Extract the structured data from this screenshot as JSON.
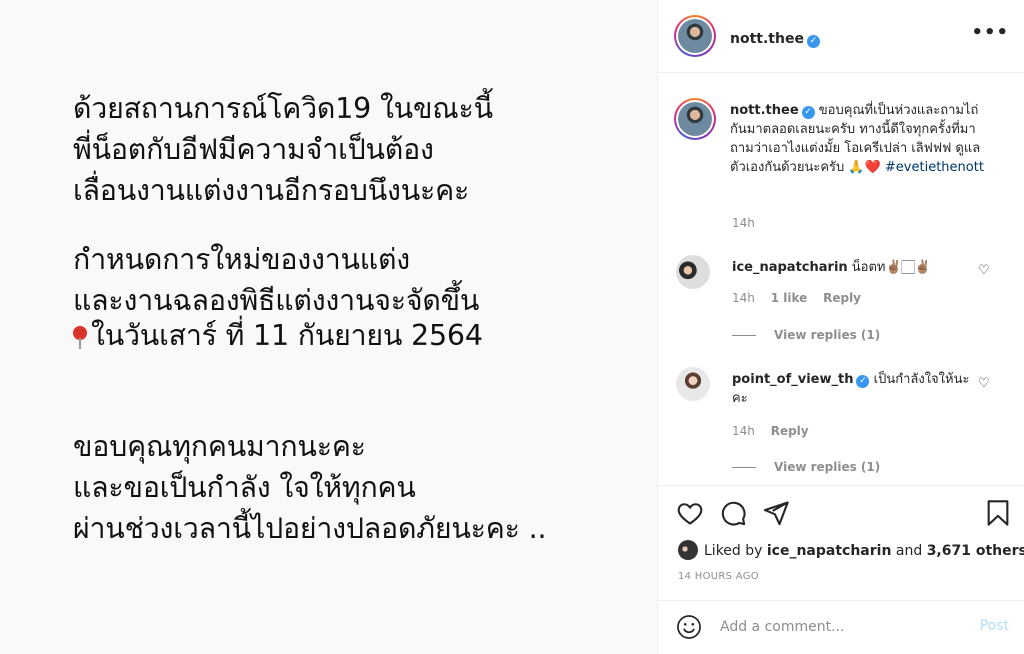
{
  "post_image": {
    "lines": [
      "ด้วยสถานการณ์โควิด19 ในขณะนี้",
      "พี่น็อตกับอีฟมีความจำเป็นต้อง",
      "เลื่อนงานแต่งงานอีกรอบนึงนะคะ",
      "กำหนดการใหม่ของงานแต่ง",
      "และงานฉลองพิธีแต่งงานจะจัดขึ้น",
      "ในวันเสาร์ ที่ 11 กันยายน 2564",
      "ขอบคุณทุกคนมากนะคะ",
      "และขอเป็นกำลัง ใจให้ทุกคน",
      "ผ่านช่วงเวลานี้ไปอย่างปลอดภัยนะคะ .."
    ]
  },
  "header": {
    "username": "nott.thee",
    "more_label": "•••"
  },
  "caption": {
    "username": "nott.thee",
    "text": "ขอบคุณที่เป็นห่วงและถามไถ่กันมาตลอดเลยนะครับ ทางนี้ดีใจทุกครั้งที่มาถามว่าเอาไงแต่งมั้ย โอเครีเปล่า เลิฟฟฟ ดูแลตัวเองกันด้วยนะครับ 🙏❤️",
    "hashtag": "#evetiethenott",
    "time": "14h"
  },
  "comments": [
    {
      "username": "ice_napatcharin",
      "text": "น็อตท✌🏽🏻✌🏽",
      "time": "14h",
      "likes": "1 like",
      "reply": "Reply",
      "view_replies": "View replies (1)"
    },
    {
      "username": "point_of_view_th",
      "text": "เป็นกำลังใจให้นะคะ",
      "time": "14h",
      "reply": "Reply",
      "view_replies": "View replies (1)"
    }
  ],
  "likes": {
    "prefix": "Liked by",
    "user": "ice_napatcharin",
    "middle": "and",
    "others": "3,671 others"
  },
  "timestamp": "14 HOURS AGO",
  "add_comment": {
    "placeholder": "Add a comment...",
    "post_label": "Post"
  },
  "colors": {
    "verified": "#3897f0",
    "post_button": "#b2dffc",
    "hashtag": "#00376b"
  }
}
